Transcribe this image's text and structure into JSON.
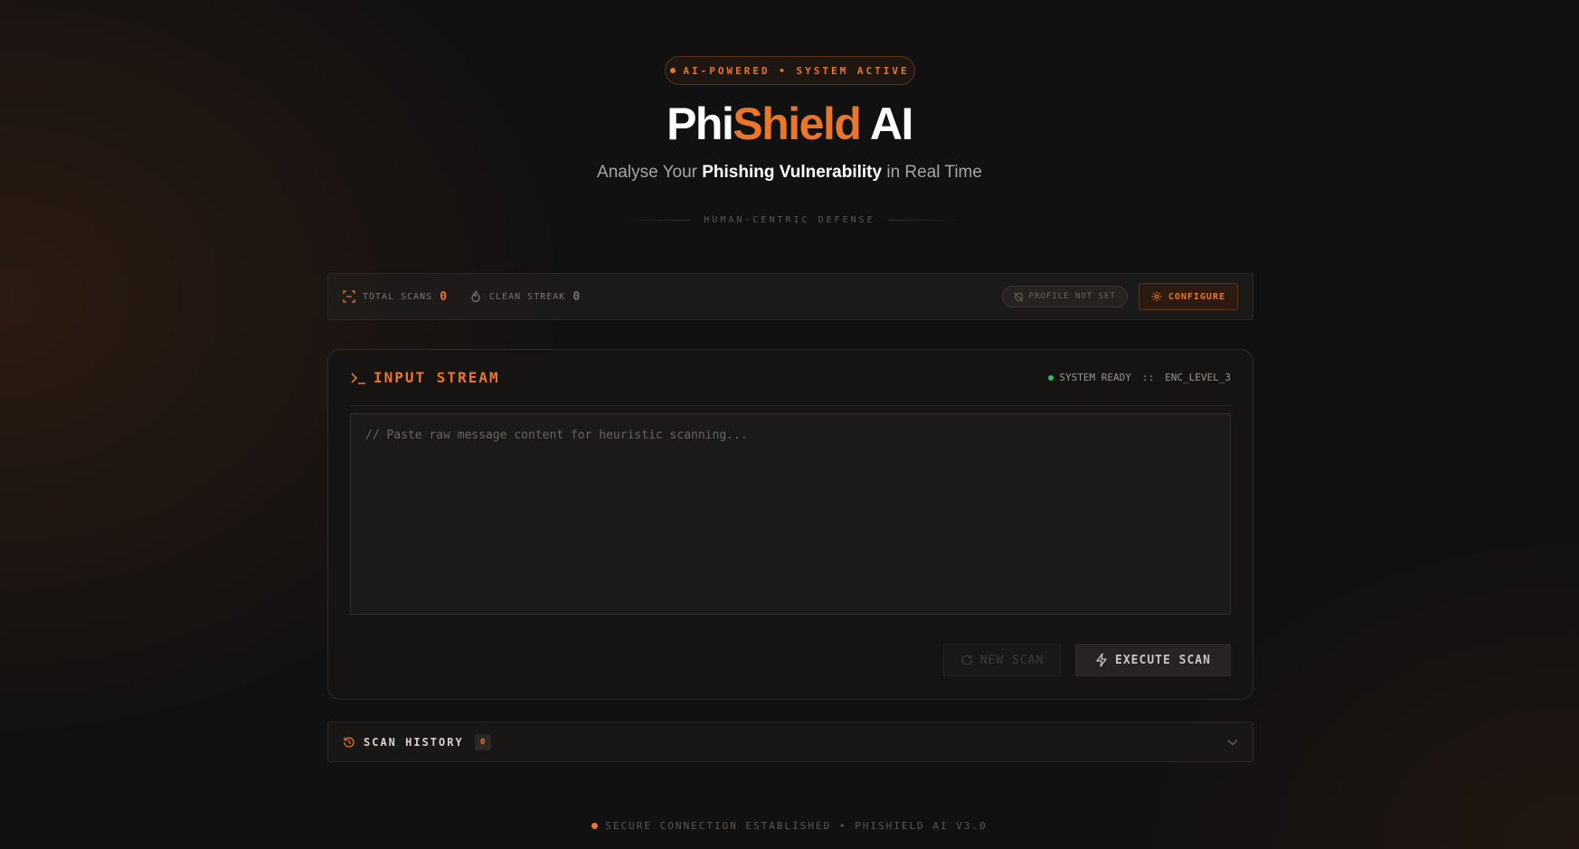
{
  "header": {
    "badge": "AI-POWERED • SYSTEM ACTIVE",
    "title_part1": "Phi",
    "title_part2": "Shield",
    "title_part3": " AI",
    "subtitle_pre": "Analyse Your ",
    "subtitle_bold": "Phishing Vulnerability",
    "subtitle_post": " in Real Time",
    "divider_text": "HUMAN-CENTRIC DEFENSE"
  },
  "stats": {
    "total_scans_label": "TOTAL SCANS",
    "total_scans_value": "0",
    "clean_streak_label": "CLEAN STREAK",
    "clean_streak_value": "0",
    "profile_label": "PROFILE NOT SET",
    "configure_label": "CONFIGURE"
  },
  "input_panel": {
    "title": "INPUT STREAM",
    "system_status": "SYSTEM READY",
    "separator": "::",
    "enc_level": "ENC_LEVEL_3",
    "placeholder": "// Paste raw message content for heuristic scanning...",
    "new_scan_label": "NEW SCAN",
    "execute_scan_label": "EXECUTE SCAN"
  },
  "history": {
    "label": "SCAN HISTORY",
    "count": "0"
  },
  "footer": {
    "text": "SECURE CONNECTION ESTABLISHED • PHISHIELD AI V3.0"
  },
  "colors": {
    "accent": "#e8762b",
    "ready": "#22c55e",
    "background": "#121111"
  }
}
